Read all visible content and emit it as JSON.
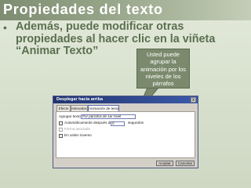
{
  "slide": {
    "title": "Propiedades del texto",
    "bullet_mark": "•",
    "bullet_text": "Además, puede modificar otras propiedades al hacer clic en la viñeta “Animar Texto”",
    "callout": "Usted puede agrupar la animación por los niveles de los párrafos"
  },
  "dialog": {
    "title": "Desplegar hacia arriba",
    "close": "x",
    "tabs": [
      {
        "label": "Efecto"
      },
      {
        "label": "Intervalos"
      },
      {
        "label": "Animación de texto"
      }
    ],
    "group_label": "Agrupar texto:",
    "group_value": "Por párrafos de 1er nivel",
    "auto_label": "Automáticamente después de",
    "auto_value": "0",
    "auto_unit": "segundos",
    "attached_label": "Forma asociada",
    "reverse_label": "En orden inverso",
    "ok_label": "Aceptar",
    "cancel_label": "Cancelar"
  },
  "colors": {
    "title_band": "#95a387",
    "bullet_text": "#5b6f50",
    "callout_bg": "#7b8a6d",
    "dialog_title": "#21346f"
  }
}
